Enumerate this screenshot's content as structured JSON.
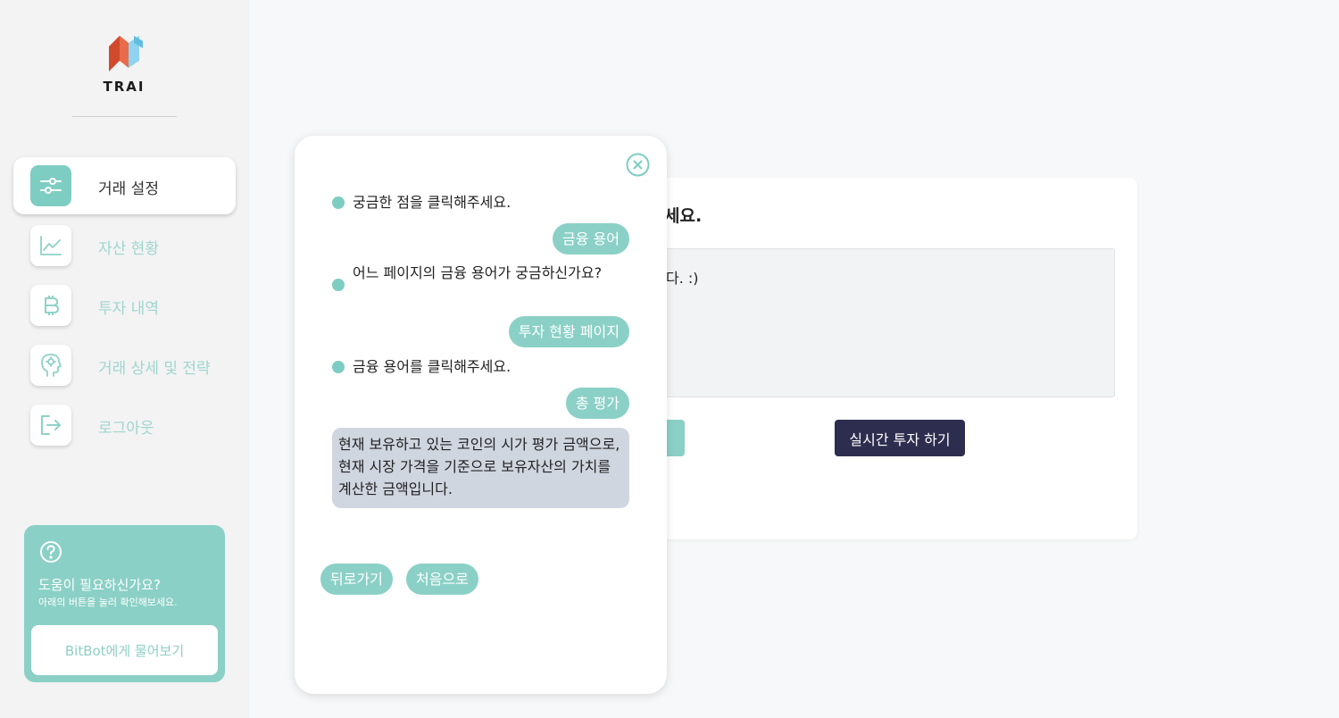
{
  "brand": {
    "name": "TRAI"
  },
  "sidebar": {
    "items": [
      {
        "label": "거래 설정",
        "icon": "sliders-icon",
        "active": true
      },
      {
        "label": "자산 현황",
        "icon": "line-chart-icon",
        "active": false
      },
      {
        "label": "투자 내역",
        "icon": "bitcoin-icon",
        "active": false
      },
      {
        "label": "거래 상세 및 전략",
        "icon": "brain-head-icon",
        "active": false
      },
      {
        "label": "로그아웃",
        "icon": "logout-icon",
        "active": false
      }
    ],
    "help": {
      "icon": "question-circle-icon",
      "title": "도움이 필요하신가요?",
      "subtitle": "아래의 버튼을 눌러 확인해보세요.",
      "button": "BitBot에게 물어보기"
    }
  },
  "main_card": {
    "title_visible": "세요.",
    "box_text_visible": "다. :)",
    "realtime_button": "실시간 투자 하기"
  },
  "chatbot": {
    "close_icon": "close-circle-icon",
    "messages": [
      {
        "from": "bot",
        "text": "궁금한 점을 클릭해주세요."
      },
      {
        "from": "user",
        "text": "금융 용어"
      },
      {
        "from": "bot",
        "text": "어느 페이지의 금융 용어가 궁금하신가요?"
      },
      {
        "from": "user",
        "text": "투자 현황 페이지"
      },
      {
        "from": "bot",
        "text": "금융 용어를 클릭해주세요."
      },
      {
        "from": "user",
        "text": "총 평가"
      },
      {
        "from": "bot",
        "text": "현재 보유하고 있는 코인의 시가 평가 금액으로, 현재 시장 가격을 기준으로 보유자산의 가치를 계산한 금액입니다."
      }
    ],
    "actions": {
      "back": "뒤로가기",
      "home": "처음으로"
    }
  },
  "colors": {
    "mint": "#8bd0c6",
    "mint_dark": "#7ecdc3",
    "navy": "#2d2d4f",
    "answer_bg": "#d0d6e0",
    "logo_red": "#d24a2e",
    "logo_blue": "#8fd3f0"
  }
}
